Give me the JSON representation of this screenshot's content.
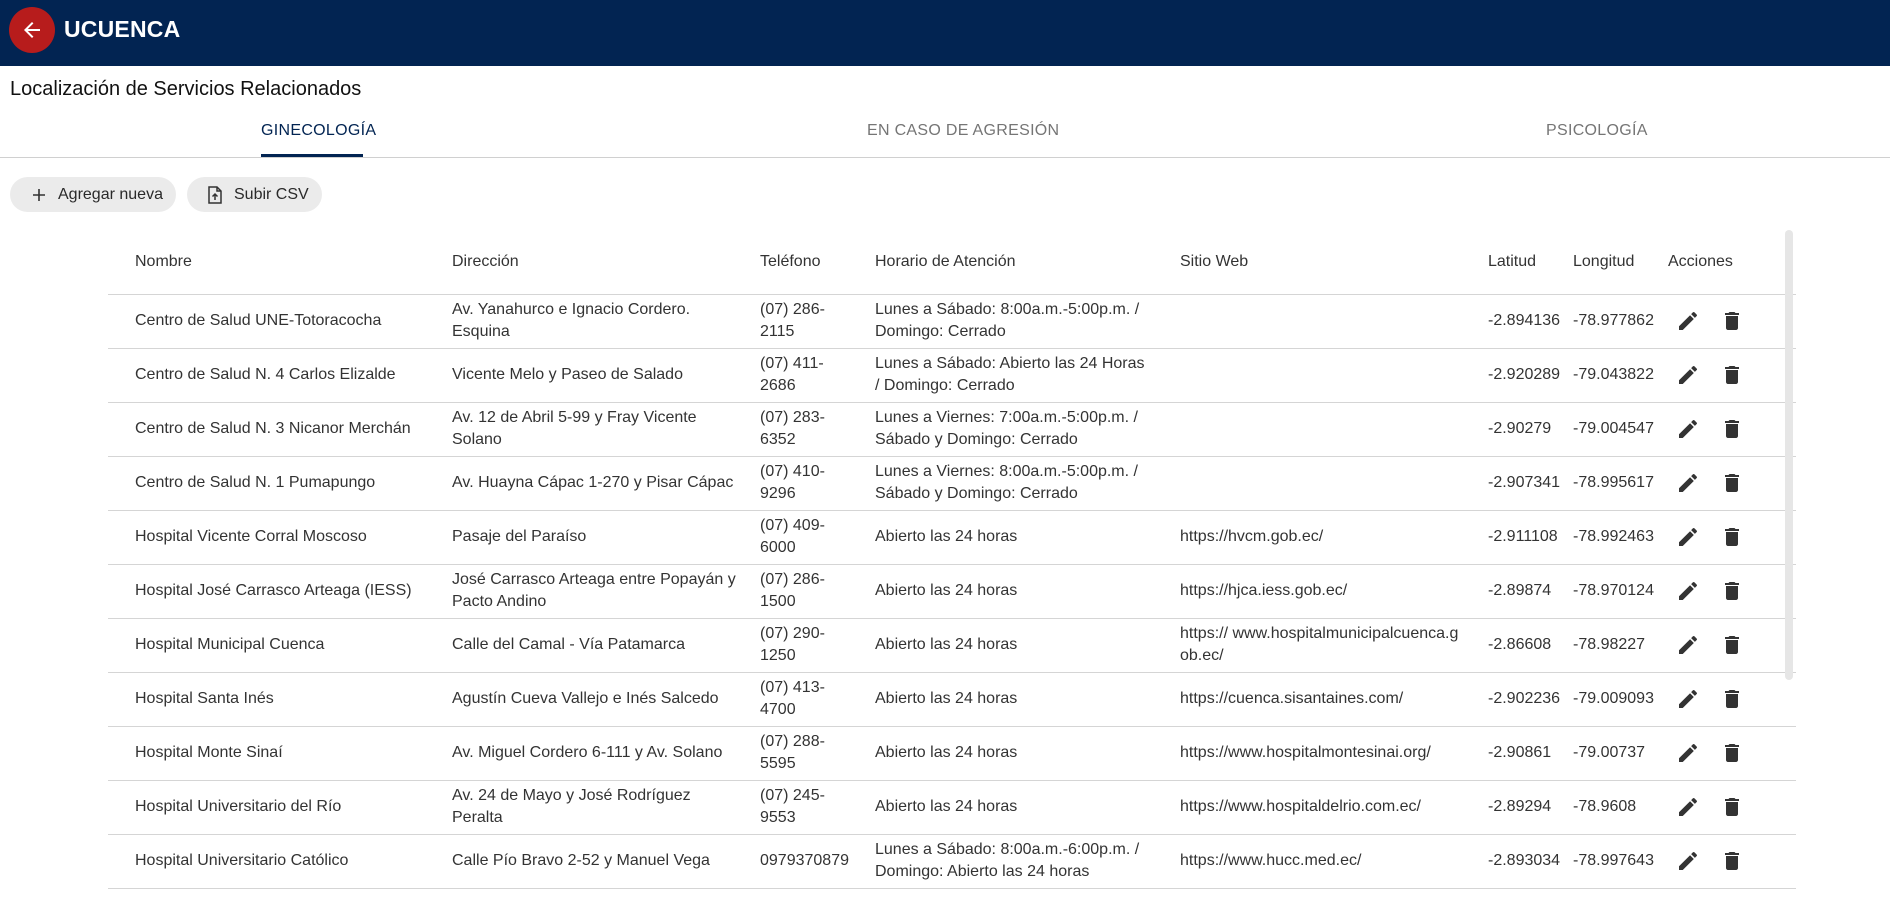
{
  "app": {
    "title": "UCUENCA",
    "back_icon": "arrow-left-icon"
  },
  "page": {
    "title": "Localización de Servicios Relacionados"
  },
  "tabs": [
    {
      "label": "GINECOLOGÍA",
      "active": true
    },
    {
      "label": "EN CASO DE AGRESIÓN",
      "active": false
    },
    {
      "label": "PSICOLOGÍA",
      "active": false
    }
  ],
  "toolbar": {
    "add_label": "Agregar nueva",
    "upload_label": "Subir CSV"
  },
  "table": {
    "headers": [
      "Nombre",
      "Dirección",
      "Teléfono",
      "Horario de Atención",
      "Sitio Web",
      "Latitud",
      "Longitud",
      "Acciones"
    ],
    "rows": [
      [
        "Centro de Salud UNE-Totoracocha",
        "Av. Yanahurco e Ignacio Cordero. Esquina",
        "(07) 286-2115",
        "Lunes a Sábado: 8:00a.m.-5:00p.m. / Domingo: Cerrado",
        "",
        "-2.894136",
        "-78.977862"
      ],
      [
        "Centro de Salud N. 4 Carlos Elizalde",
        "Vicente Melo y Paseo de Salado",
        "(07) 411-2686",
        "Lunes a Sábado: Abierto las 24 Horas / Domingo: Cerrado",
        "",
        "-2.920289",
        "-79.043822"
      ],
      [
        "Centro de Salud N. 3 Nicanor Merchán",
        "Av. 12 de Abril 5-99 y Fray Vicente Solano",
        "(07) 283-6352",
        "Lunes a Viernes: 7:00a.m.-5:00p.m. / Sábado y Domingo: Cerrado",
        "",
        "-2.90279",
        "-79.004547"
      ],
      [
        "Centro de Salud N. 1 Pumapungo",
        "Av. Huayna Cápac 1-270 y Pisar Cápac",
        "(07) 410-9296",
        "Lunes a Viernes: 8:00a.m.-5:00p.m. / Sábado y Domingo: Cerrado",
        "",
        "-2.907341",
        "-78.995617"
      ],
      [
        "Hospital Vicente Corral Moscoso",
        "Pasaje del Paraíso",
        "(07) 409-6000",
        "Abierto las 24 horas",
        "https://hvcm.gob.ec/",
        "-2.911108",
        "-78.992463"
      ],
      [
        "Hospital José Carrasco Arteaga (IESS)",
        "José Carrasco Arteaga entre Popayán y Pacto Andino",
        "(07) 286-1500",
        "Abierto las 24 horas",
        "https://hjca.iess.gob.ec/",
        "-2.89874",
        "-78.970124"
      ],
      [
        "Hospital Municipal Cuenca",
        "Calle del Camal - Vía Patamarca",
        "(07) 290-1250",
        "Abierto las 24 horas",
        "https:// www.hospitalmunicipalcuenca.gob.ec/",
        "-2.86608",
        "-78.98227"
      ],
      [
        "Hospital Santa Inés",
        "Agustín Cueva Vallejo e Inés Salcedo",
        "(07) 413-4700",
        "Abierto las 24 horas",
        "https://cuenca.sisantaines.com/",
        "-2.902236",
        "-79.009093"
      ],
      [
        "Hospital Monte Sinaí",
        "Av. Miguel Cordero 6-111 y Av. Solano",
        "(07) 288-5595",
        "Abierto las 24 horas",
        "https://www.hospitalmontesinai.org/",
        "-2.90861",
        "-79.00737"
      ],
      [
        "Hospital Universitario del Río",
        "Av. 24 de Mayo y José Rodríguez Peralta",
        "(07) 245-9553",
        "Abierto las 24 horas",
        "https://www.hospitaldelrio.com.ec/",
        "-2.89294",
        "-78.9608"
      ],
      [
        "Hospital Universitario Católico",
        "Calle Pío Bravo 2-52 y Manuel Vega",
        "0979370879",
        "Lunes a Sábado: 8:00a.m.-6:00p.m. / Domingo: Abierto las 24 horas",
        "https://www.hucc.med.ec/",
        "-2.893034",
        "-78.997643"
      ]
    ],
    "action_icons": [
      "edit-icon",
      "delete-icon"
    ]
  },
  "colors": {
    "app_bar": "#022452",
    "back_button": "#b71c1c",
    "chip_bg": "#ebebeb"
  }
}
